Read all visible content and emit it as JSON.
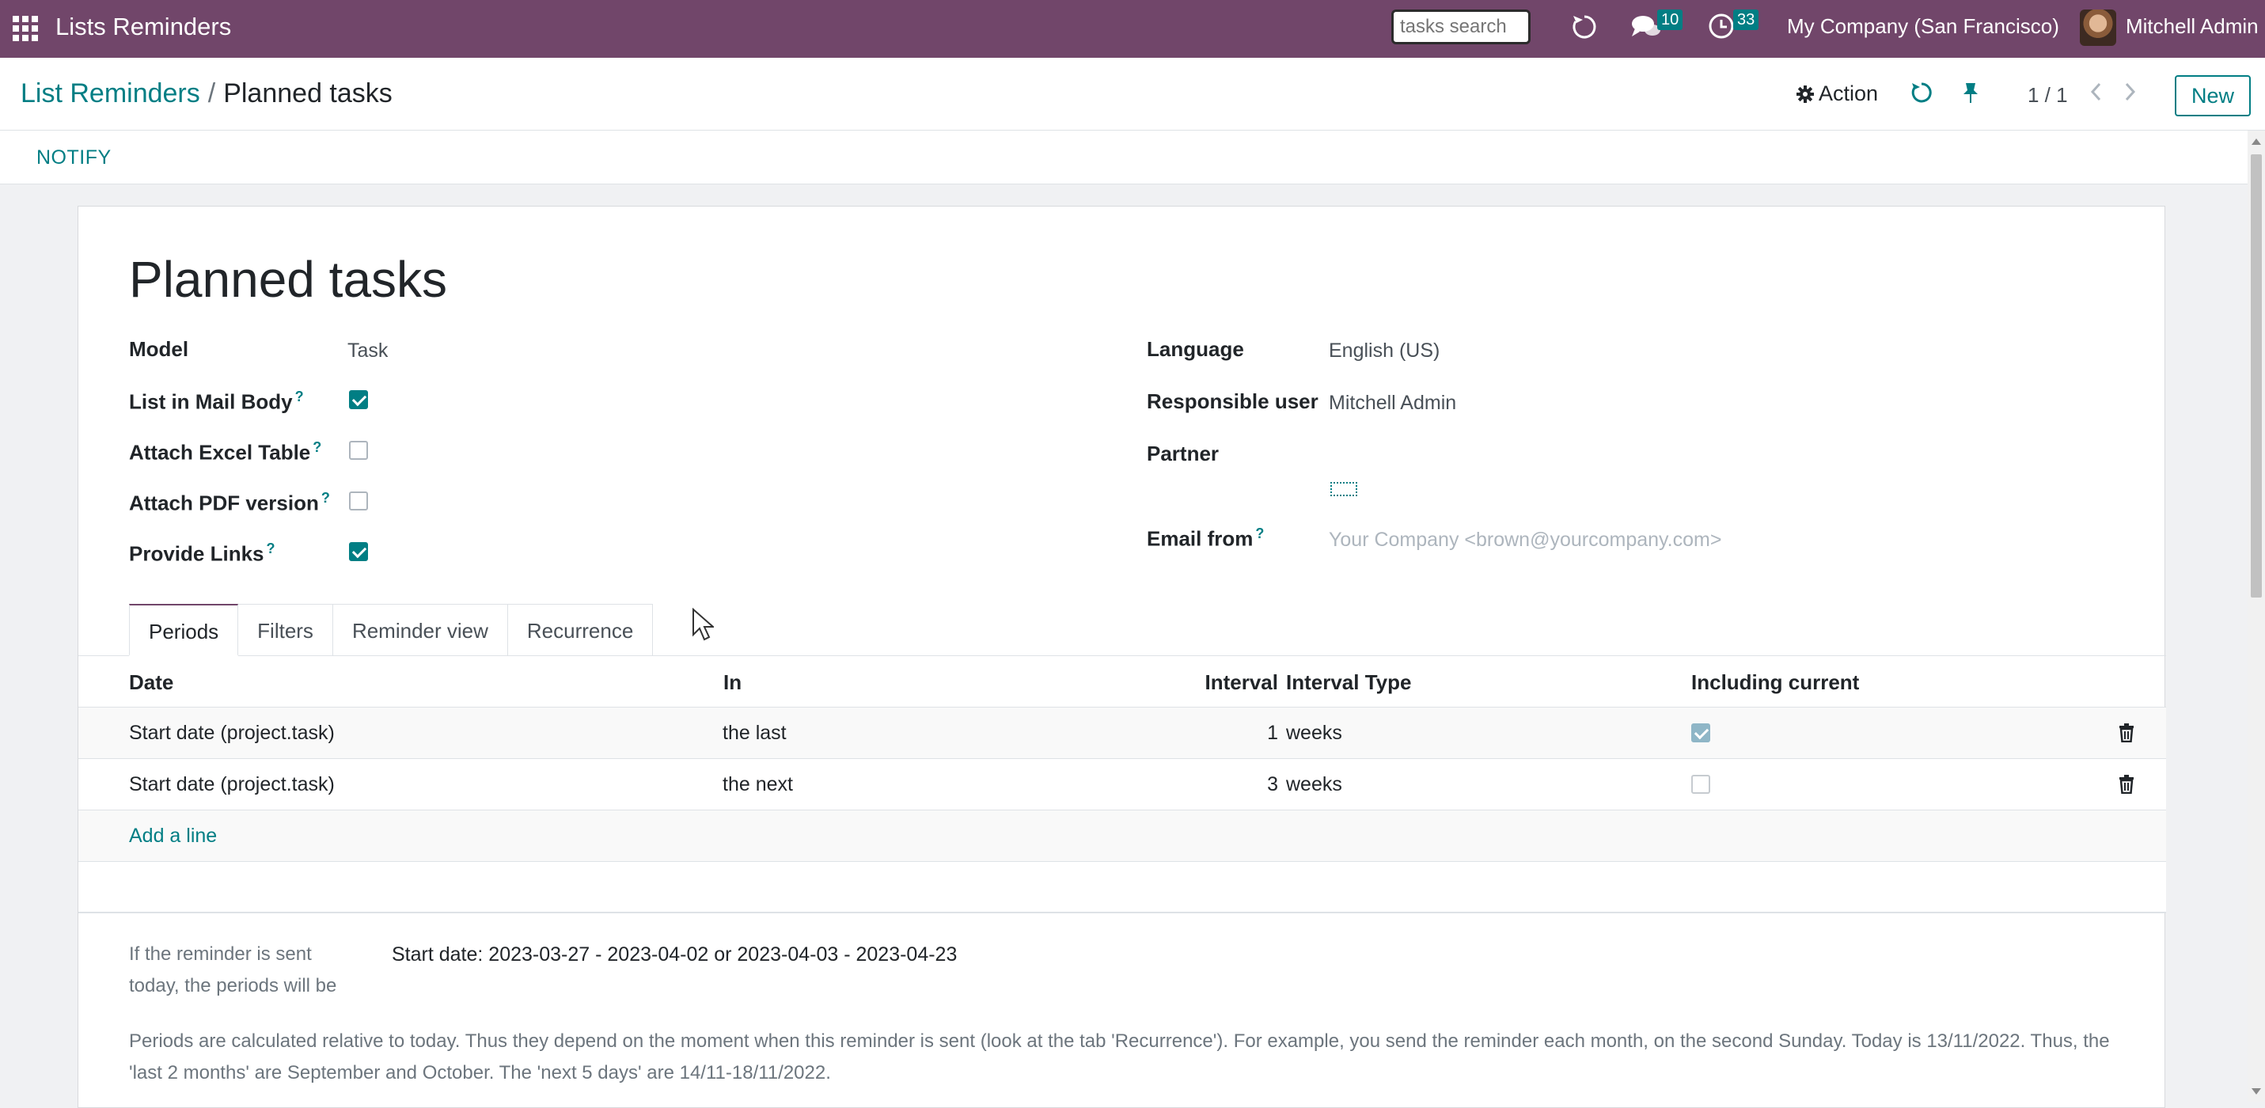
{
  "navbar": {
    "app_title": "Lists Reminders",
    "search_placeholder": "tasks search",
    "messages_count": "10",
    "activities_count": "33",
    "company": "My Company (San Francisco)",
    "user": "Mitchell Admin"
  },
  "control_panel": {
    "breadcrumb_parent": "List Reminders",
    "breadcrumb_separator": "/",
    "breadcrumb_current": "Planned tasks",
    "action_label": "Action",
    "pager": "1 / 1",
    "new_label": "New"
  },
  "statusbar": {
    "notify_label": "NOTIFY"
  },
  "record": {
    "title": "Planned tasks",
    "left_fields": {
      "model_label": "Model",
      "model_value": "Task",
      "list_in_mail_label": "List in Mail Body",
      "list_in_mail_checked": true,
      "attach_excel_label": "Attach Excel Table",
      "attach_excel_checked": false,
      "attach_pdf_label": "Attach PDF version",
      "attach_pdf_checked": false,
      "provide_links_label": "Provide Links",
      "provide_links_checked": true
    },
    "right_fields": {
      "language_label": "Language",
      "language_value": "English (US)",
      "responsible_label": "Responsible user",
      "responsible_value": "Mitchell Admin",
      "partner_label": "Partner",
      "email_from_label": "Email from",
      "email_from_placeholder": "Your Company <brown@yourcompany.com>"
    },
    "help_mark": "?"
  },
  "tabs": [
    "Periods",
    "Filters",
    "Reminder view",
    "Recurrence"
  ],
  "periods_table": {
    "headers": [
      "Date",
      "In",
      "Interval",
      "Interval Type",
      "Including current"
    ],
    "rows": [
      {
        "date": "Start date (project.task)",
        "in": "the last",
        "interval": "1",
        "interval_type": "weeks",
        "including_current": true
      },
      {
        "date": "Start date (project.task)",
        "in": "the next",
        "interval": "3",
        "interval_type": "weeks",
        "including_current": false
      }
    ],
    "add_line": "Add a line"
  },
  "preview": {
    "label": "If the reminder is sent today, the periods will be",
    "value": "Start date: 2023-03-27 - 2023-04-02 or 2023-04-03 - 2023-04-23"
  },
  "note": "Periods are calculated relative to today. Thus they depend on the moment when this reminder is sent (look at the tab 'Recurrence'). For example, you send the reminder each month, on the second Sunday. Today is 13/11/2022. Thus, the 'last 2 months' are September and October. The 'next 5 days' are 14/11-18/11/2022.",
  "colors": {
    "navbar": "#71466a",
    "accent": "#017e84"
  }
}
